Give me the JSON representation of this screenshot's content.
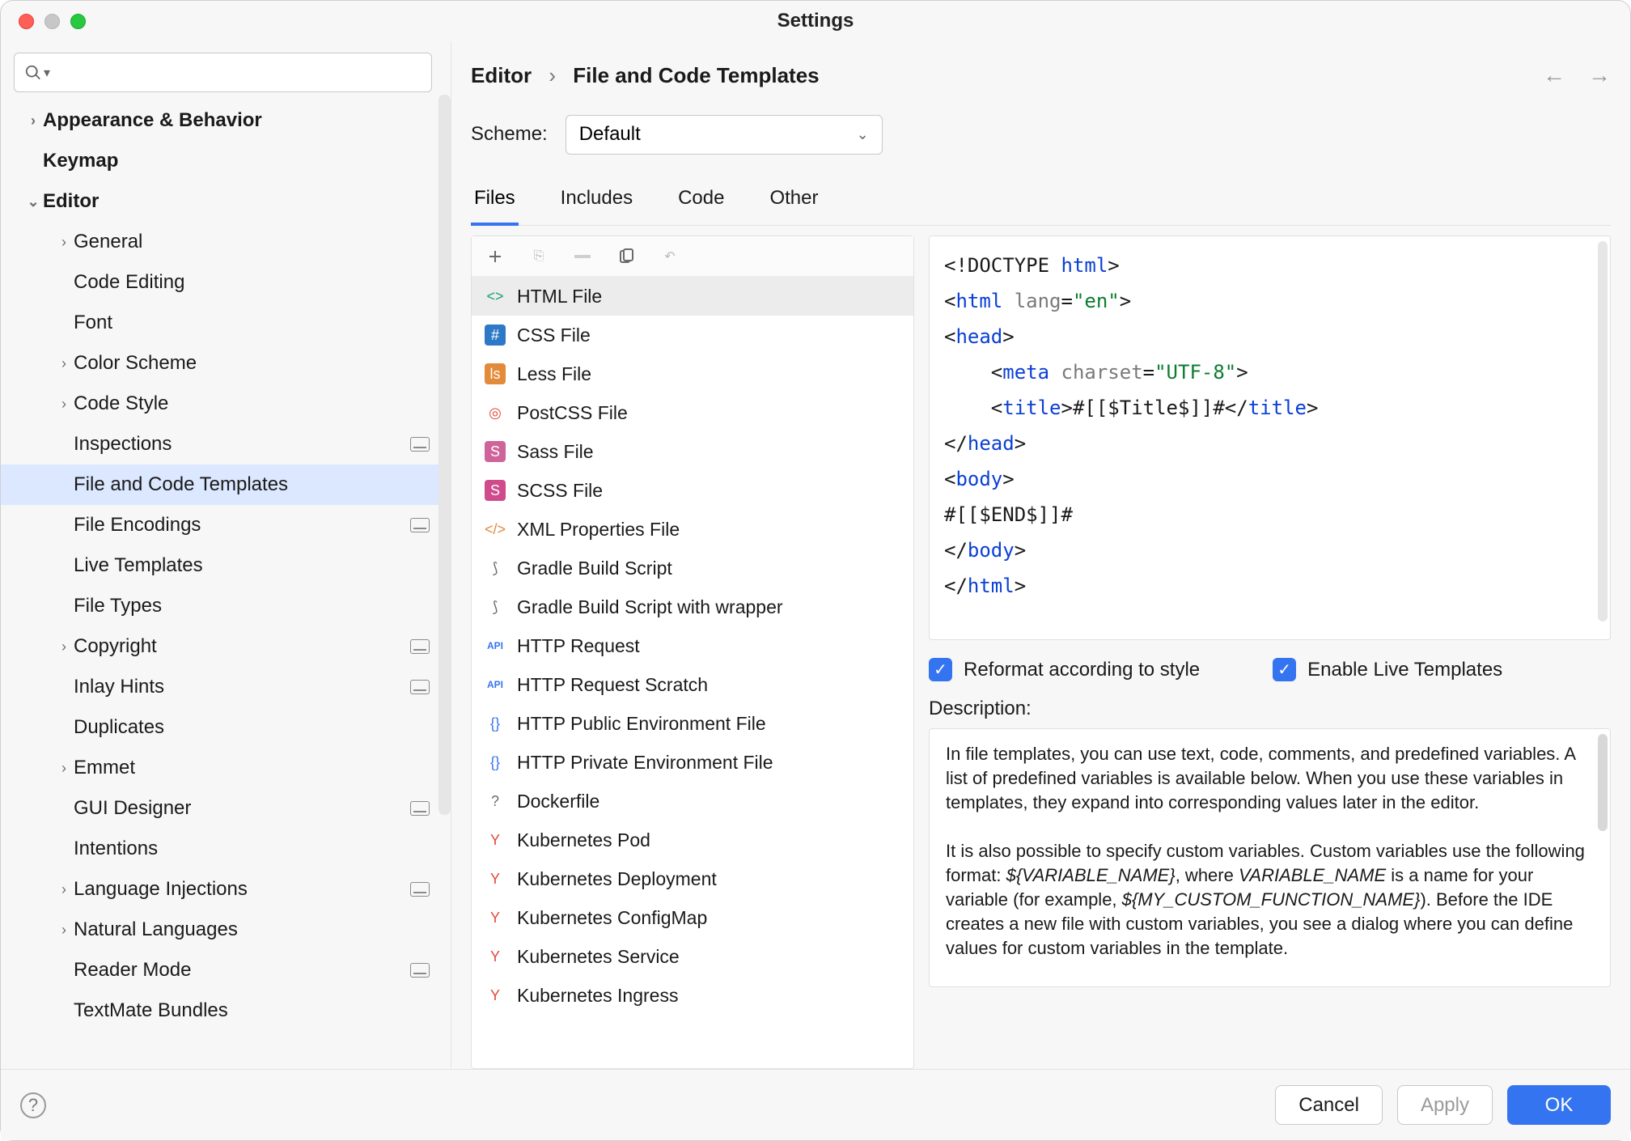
{
  "window": {
    "title": "Settings"
  },
  "search": {
    "placeholder": ""
  },
  "breadcrumb": {
    "root": "Editor",
    "leaf": "File and Code Templates"
  },
  "scheme": {
    "label": "Scheme:",
    "value": "Default"
  },
  "tabs": [
    {
      "label": "Files",
      "active": true
    },
    {
      "label": "Includes",
      "active": false
    },
    {
      "label": "Code",
      "active": false
    },
    {
      "label": "Other",
      "active": false
    }
  ],
  "tree": [
    {
      "label": "Appearance & Behavior",
      "bold": true,
      "chev": "right",
      "indent": 0
    },
    {
      "label": "Keymap",
      "bold": true,
      "indent": 0
    },
    {
      "label": "Editor",
      "bold": true,
      "chev": "down",
      "indent": 0
    },
    {
      "label": "General",
      "chev": "right",
      "indent": 1
    },
    {
      "label": "Code Editing",
      "indent": 1
    },
    {
      "label": "Font",
      "indent": 1
    },
    {
      "label": "Color Scheme",
      "chev": "right",
      "indent": 1
    },
    {
      "label": "Code Style",
      "chev": "right",
      "indent": 1
    },
    {
      "label": "Inspections",
      "indent": 1,
      "badge": true
    },
    {
      "label": "File and Code Templates",
      "indent": 1,
      "selected": true
    },
    {
      "label": "File Encodings",
      "indent": 1,
      "badge": true
    },
    {
      "label": "Live Templates",
      "indent": 1
    },
    {
      "label": "File Types",
      "indent": 1
    },
    {
      "label": "Copyright",
      "chev": "right",
      "indent": 1,
      "badge": true
    },
    {
      "label": "Inlay Hints",
      "indent": 1,
      "badge": true
    },
    {
      "label": "Duplicates",
      "indent": 1
    },
    {
      "label": "Emmet",
      "chev": "right",
      "indent": 1
    },
    {
      "label": "GUI Designer",
      "indent": 1,
      "badge": true
    },
    {
      "label": "Intentions",
      "indent": 1
    },
    {
      "label": "Language Injections",
      "chev": "right",
      "indent": 1,
      "badge": true
    },
    {
      "label": "Natural Languages",
      "chev": "right",
      "indent": 1
    },
    {
      "label": "Reader Mode",
      "indent": 1,
      "badge": true
    },
    {
      "label": "TextMate Bundles",
      "indent": 1
    }
  ],
  "templates": [
    {
      "label": "HTML File",
      "icon": "html",
      "selected": true
    },
    {
      "label": "CSS File",
      "icon": "css"
    },
    {
      "label": "Less File",
      "icon": "less"
    },
    {
      "label": "PostCSS File",
      "icon": "postcss"
    },
    {
      "label": "Sass File",
      "icon": "sass"
    },
    {
      "label": "SCSS File",
      "icon": "scss"
    },
    {
      "label": "XML Properties File",
      "icon": "xml"
    },
    {
      "label": "Gradle Build Script",
      "icon": "gradle"
    },
    {
      "label": "Gradle Build Script with wrapper",
      "icon": "gradle"
    },
    {
      "label": "HTTP Request",
      "icon": "api"
    },
    {
      "label": "HTTP Request Scratch",
      "icon": "api"
    },
    {
      "label": "HTTP Public Environment File",
      "icon": "json"
    },
    {
      "label": "HTTP Private Environment File",
      "icon": "json"
    },
    {
      "label": "Dockerfile",
      "icon": "docker"
    },
    {
      "label": "Kubernetes Pod",
      "icon": "yaml"
    },
    {
      "label": "Kubernetes Deployment",
      "icon": "yaml"
    },
    {
      "label": "Kubernetes ConfigMap",
      "icon": "yaml"
    },
    {
      "label": "Kubernetes Service",
      "icon": "yaml"
    },
    {
      "label": "Kubernetes Ingress",
      "icon": "yaml"
    }
  ],
  "template_code_tokens": [
    {
      "t": "<!",
      "c": "p"
    },
    {
      "t": "DOCTYPE ",
      "c": "p"
    },
    {
      "t": "html",
      "c": "tag"
    },
    {
      "t": ">",
      "c": "p"
    },
    {
      "t": "\n"
    },
    {
      "t": "<",
      "c": "p"
    },
    {
      "t": "html ",
      "c": "tag"
    },
    {
      "t": "lang",
      "c": "attr"
    },
    {
      "t": "=",
      "c": "p"
    },
    {
      "t": "\"en\"",
      "c": "str"
    },
    {
      "t": ">",
      "c": "p"
    },
    {
      "t": "\n"
    },
    {
      "t": "<",
      "c": "p"
    },
    {
      "t": "head",
      "c": "tag"
    },
    {
      "t": ">",
      "c": "p"
    },
    {
      "t": "\n"
    },
    {
      "t": "    <",
      "c": "p"
    },
    {
      "t": "meta ",
      "c": "tag"
    },
    {
      "t": "charset",
      "c": "attr"
    },
    {
      "t": "=",
      "c": "p"
    },
    {
      "t": "\"UTF-8\"",
      "c": "str"
    },
    {
      "t": ">",
      "c": "p"
    },
    {
      "t": "\n"
    },
    {
      "t": "    <",
      "c": "p"
    },
    {
      "t": "title",
      "c": "tag"
    },
    {
      "t": ">",
      "c": "p"
    },
    {
      "t": "#[[$Title$]]#",
      "c": "p"
    },
    {
      "t": "</",
      "c": "p"
    },
    {
      "t": "title",
      "c": "tag"
    },
    {
      "t": ">",
      "c": "p"
    },
    {
      "t": "\n"
    },
    {
      "t": "</",
      "c": "p"
    },
    {
      "t": "head",
      "c": "tag"
    },
    {
      "t": ">",
      "c": "p"
    },
    {
      "t": "\n"
    },
    {
      "t": "<",
      "c": "p"
    },
    {
      "t": "body",
      "c": "tag"
    },
    {
      "t": ">",
      "c": "p"
    },
    {
      "t": "\n"
    },
    {
      "t": "#[[$END$]]#",
      "c": "p"
    },
    {
      "t": "\n"
    },
    {
      "t": "</",
      "c": "p"
    },
    {
      "t": "body",
      "c": "tag"
    },
    {
      "t": ">",
      "c": "p"
    },
    {
      "t": "\n"
    },
    {
      "t": "</",
      "c": "p"
    },
    {
      "t": "html",
      "c": "tag"
    },
    {
      "t": ">",
      "c": "p"
    }
  ],
  "checks": {
    "reformat": {
      "label": "Reformat according to style",
      "checked": true
    },
    "live": {
      "label": "Enable Live Templates",
      "checked": true
    }
  },
  "description": {
    "label": "Description:",
    "p1a": "In file templates, you can use text, code, comments, and predefined variables. A list of predefined variables is available below. When you use these variables in templates, they expand into corresponding values later in the editor.",
    "p2a": "It is also possible to specify custom variables. Custom variables use the following format: ",
    "p2v1": "${VARIABLE_NAME}",
    "p2b": ", where ",
    "p2v2": "VARIABLE_NAME",
    "p2c": " is a name for your variable (for example, ",
    "p2v3": "${MY_CUSTOM_FUNCTION_NAME}",
    "p2d": "). Before the IDE creates a new file with custom variables, you see a dialog where you can define values for custom variables in the template."
  },
  "footer": {
    "cancel": "Cancel",
    "apply": "Apply",
    "ok": "OK"
  },
  "icon_map": {
    "html": {
      "glyph": "<>",
      "fg": "#1aa36a",
      "bg": ""
    },
    "css": {
      "glyph": "#",
      "fg": "#fff",
      "bg": "#2d79c7"
    },
    "less": {
      "glyph": "ls",
      "fg": "#fff",
      "bg": "#e28b3a"
    },
    "postcss": {
      "glyph": "◎",
      "fg": "#e2483a",
      "bg": ""
    },
    "sass": {
      "glyph": "S",
      "fg": "#fff",
      "bg": "#cf649a"
    },
    "scss": {
      "glyph": "S",
      "fg": "#fff",
      "bg": "#cf4b8c"
    },
    "xml": {
      "glyph": "</>",
      "fg": "#e2893a",
      "bg": ""
    },
    "gradle": {
      "glyph": "⟆",
      "fg": "#6b6b6b",
      "bg": ""
    },
    "api": {
      "glyph": "API",
      "fg": "#3574f0",
      "bg": ""
    },
    "json": {
      "glyph": "{}",
      "fg": "#3574f0",
      "bg": ""
    },
    "docker": {
      "glyph": "?",
      "fg": "#6b6b6b",
      "bg": ""
    },
    "yaml": {
      "glyph": "Y",
      "fg": "#e2483a",
      "bg": ""
    }
  }
}
